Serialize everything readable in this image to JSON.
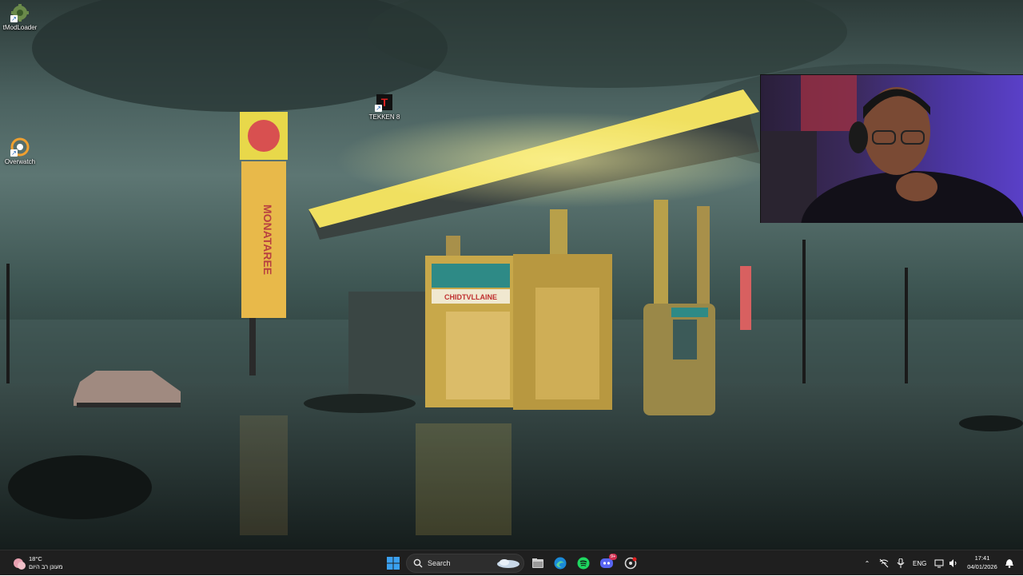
{
  "desktop": {
    "icons": [
      {
        "label": "tModLoader",
        "icon": "tmodloader-icon"
      },
      {
        "label": "Overwatch",
        "icon": "overwatch-icon"
      },
      {
        "label": "TEKKEN 8",
        "icon": "tekken8-icon"
      }
    ],
    "wallpaper": {
      "sign_text": "CHIDTVLLAINE",
      "pole_sign_text": "MONATAREE",
      "colors": {
        "sky": "#4b6260",
        "canopy": "#e8d84a",
        "ground": "#1e2826"
      }
    }
  },
  "taskbar": {
    "start_icon": "windows-start-icon",
    "search_label": "Search",
    "apps": [
      {
        "name": "file-explorer-icon"
      },
      {
        "name": "edge-icon"
      },
      {
        "name": "spotify-icon"
      },
      {
        "name": "discord-icon",
        "badge": "9+"
      },
      {
        "name": "app-icon"
      }
    ],
    "weather": {
      "temp": "18°C",
      "desc": "מעונן רב היום"
    },
    "tray": {
      "language": "ENG"
    },
    "clock": {
      "time": "17:41",
      "date": "04/01/2026"
    }
  }
}
